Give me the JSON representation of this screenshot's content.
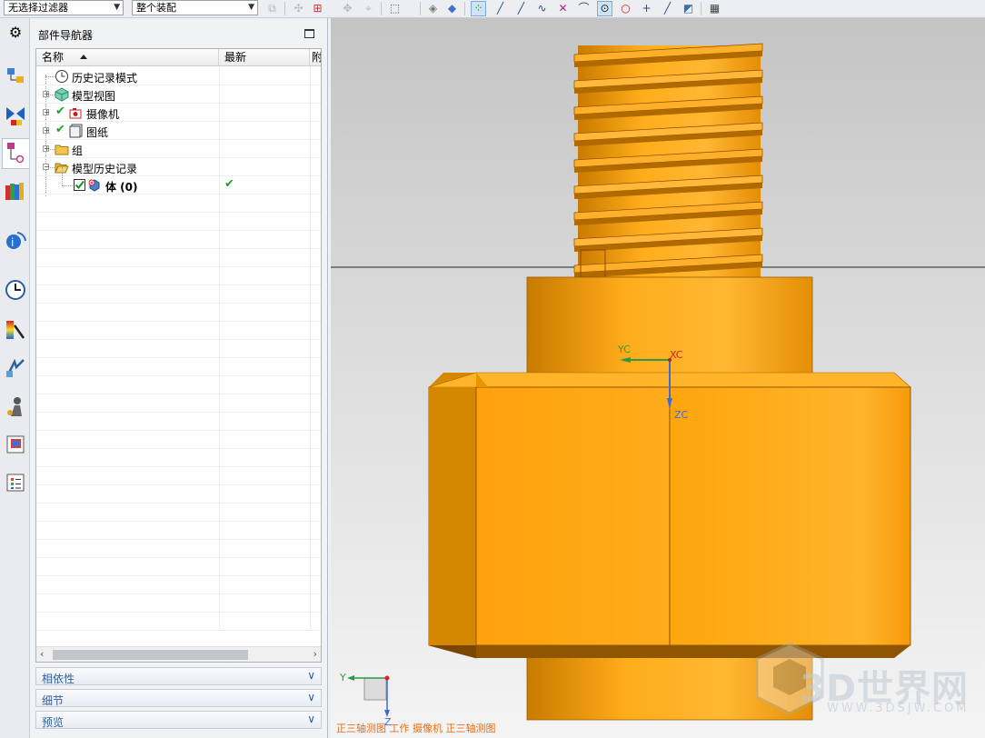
{
  "toolbar": {
    "selection_filter": "无选择过滤器",
    "assembly_scope": "整个装配",
    "icons": [
      "copy-icon",
      "snap-icon",
      "add-icon",
      "group-icon",
      "rect-select-icon",
      "shade-icon",
      "cube-icon",
      "point-snap-icon",
      "end-point-icon",
      "mid-point-icon",
      "curve-icon",
      "intersect-icon",
      "arc-icon",
      "circle-center-icon",
      "circle-icon",
      "cross-icon",
      "tangent-icon",
      "view-icon",
      "table-icon"
    ]
  },
  "resource_bar": {
    "icons": [
      "settings-icon",
      "assembly-navigator-icon",
      "constraint-navigator-icon",
      "part-navigator-icon",
      "reuse-library-icon",
      "hd3d-tools-icon",
      "history-icon",
      "system-materials-icon",
      "process-studio-icon",
      "roles-icon",
      "palette-icon",
      "list-icon"
    ]
  },
  "navigator": {
    "title": "部件导航器",
    "columns": {
      "name": "名称",
      "latest": "最新",
      "extra": "附"
    },
    "rows": [
      {
        "label": "历史记录模式",
        "icon": "clock-icon",
        "check": ""
      },
      {
        "label": "模型视图",
        "icon": "model-view-icon",
        "check": ""
      },
      {
        "label": "摄像机",
        "icon": "camera-icon",
        "check": "✔"
      },
      {
        "label": "图纸",
        "icon": "drawing-icon",
        "check": "✔"
      },
      {
        "label": "组",
        "icon": "folder-icon",
        "check": ""
      },
      {
        "label": "模型历史记录",
        "icon": "folder-open-icon",
        "check": ""
      },
      {
        "label": "体 (0)",
        "icon": "body-icon",
        "check": "✔"
      }
    ],
    "latest_check": "✔",
    "sections": {
      "dependencies": "相依性",
      "details": "细节",
      "preview": "预览"
    }
  },
  "viewport": {
    "csys": {
      "xc": "XC",
      "yc": "YC",
      "zc": "ZC"
    },
    "triad": {
      "y": "Y",
      "z": "Z"
    },
    "status": "正三轴测图 工作 摄像机 正三轴测图",
    "watermark": {
      "text": "3D世界网",
      "url": "WWW.3DSJW.COM"
    },
    "colors": {
      "body": "#ffa70f",
      "shadow": "#b96d00",
      "background": "#d8d8d8"
    }
  }
}
